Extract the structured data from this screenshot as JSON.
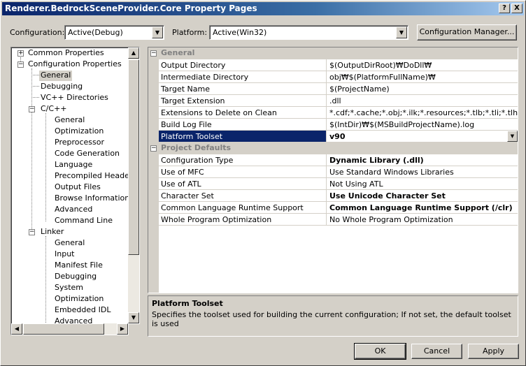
{
  "window": {
    "title": "Renderer.BedrockSceneProvider.Core Property Pages",
    "help_button": "?",
    "close_button": "X"
  },
  "toolbar": {
    "configuration_label": "Configuration:",
    "configuration_value": "Active(Debug)",
    "platform_label": "Platform:",
    "platform_value": "Active(Win32)",
    "config_manager_button": "Configuration Manager..."
  },
  "tree": {
    "items": [
      {
        "label": "Common Properties"
      },
      {
        "label": "Configuration Properties"
      },
      {
        "label": "General"
      },
      {
        "label": "Debugging"
      },
      {
        "label": "VC++ Directories"
      },
      {
        "label": "C/C++"
      },
      {
        "label": "General"
      },
      {
        "label": "Optimization"
      },
      {
        "label": "Preprocessor"
      },
      {
        "label": "Code Generation"
      },
      {
        "label": "Language"
      },
      {
        "label": "Precompiled Headers"
      },
      {
        "label": "Output Files"
      },
      {
        "label": "Browse Information"
      },
      {
        "label": "Advanced"
      },
      {
        "label": "Command Line"
      },
      {
        "label": "Linker"
      },
      {
        "label": "General"
      },
      {
        "label": "Input"
      },
      {
        "label": "Manifest File"
      },
      {
        "label": "Debugging"
      },
      {
        "label": "System"
      },
      {
        "label": "Optimization"
      },
      {
        "label": "Embedded IDL"
      },
      {
        "label": "Advanced"
      }
    ],
    "selected": "General"
  },
  "grid": {
    "categories": [
      {
        "name": "General",
        "properties": [
          {
            "name": "Output Directory",
            "value": "$(OutputDirRoot)₩DoDll₩"
          },
          {
            "name": "Intermediate Directory",
            "value": "obj₩$(PlatformFullName)₩"
          },
          {
            "name": "Target Name",
            "value": "$(ProjectName)"
          },
          {
            "name": "Target Extension",
            "value": ".dll"
          },
          {
            "name": "Extensions to Delete on Clean",
            "value": "*.cdf;*.cache;*.obj;*.ilk;*.resources;*.tlb;*.tli;*.tlh;*."
          },
          {
            "name": "Build Log File",
            "value": "$(IntDir)₩$(MSBuildProjectName).log"
          },
          {
            "name": "Platform Toolset",
            "value": "v90"
          }
        ]
      },
      {
        "name": "Project Defaults",
        "properties": [
          {
            "name": "Configuration Type",
            "value": "Dynamic Library (.dll)"
          },
          {
            "name": "Use of MFC",
            "value": "Use Standard Windows Libraries"
          },
          {
            "name": "Use of ATL",
            "value": "Not Using ATL"
          },
          {
            "name": "Character Set",
            "value": "Use Unicode Character Set"
          },
          {
            "name": "Common Language Runtime Support",
            "value": "Common Language Runtime Support (/clr)"
          },
          {
            "name": "Whole Program Optimization",
            "value": "No Whole Program Optimization"
          }
        ]
      }
    ],
    "selected_property": "Platform Toolset"
  },
  "description": {
    "title": "Platform Toolset",
    "text": "Specifies the toolset used for building the current configuration; If not set, the default toolset is used"
  },
  "buttons": {
    "ok": "OK",
    "cancel": "Cancel",
    "apply": "Apply"
  },
  "colors": {
    "title_bar": "#0a246a",
    "selection": "#0a246a",
    "face": "#d4d0c8"
  }
}
